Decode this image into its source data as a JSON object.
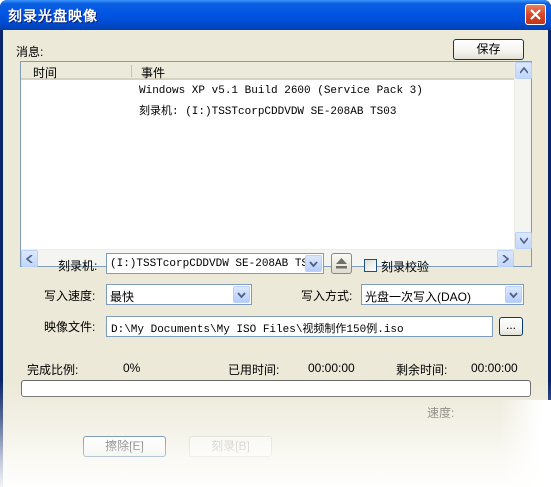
{
  "window": {
    "title": "刻录光盘映像"
  },
  "messages": {
    "label": "消息:",
    "save_button": "保存",
    "columns": [
      "时间",
      "事件"
    ],
    "rows": [
      {
        "time": "",
        "event": "Windows XP v5.1 Build 2600 (Service Pack 3)"
      },
      {
        "time": "",
        "event": "刻录机: (I:)TSSTcorpCDDVDW SE-208AB TS03"
      }
    ]
  },
  "form": {
    "burner_label": "刻录机:",
    "burner_value": "(I:)TSSTcorpCDDVDW SE-208AB TS03",
    "verify_label": "刻录校验",
    "verify_checked": false,
    "speed_label": "写入速度:",
    "speed_value": "最快",
    "mode_label": "写入方式:",
    "mode_value": "光盘一次写入(DAO)",
    "image_label": "映像文件:",
    "image_value": "D:\\My Documents\\My ISO Files\\视频制作150例.iso",
    "browse_label": "..."
  },
  "status": {
    "complete_label": "完成比例:",
    "complete_value": "0%",
    "elapsed_label": "已用时间:",
    "elapsed_value": "00:00:00",
    "remaining_label": "剩余时间:",
    "remaining_value": "00:00:00",
    "progress": 0,
    "speed_label": "速度:"
  },
  "buttons": {
    "erase": "擦除[E]",
    "burn": "刻录[B]"
  }
}
